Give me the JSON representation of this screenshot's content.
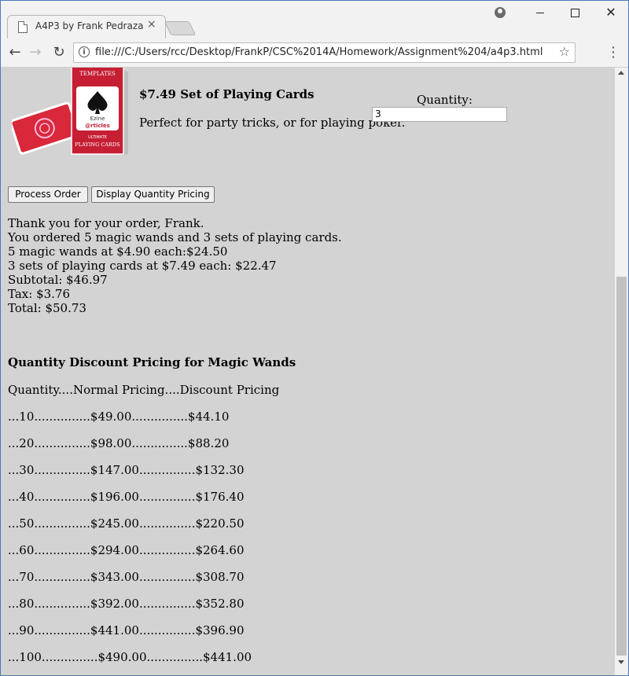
{
  "browser": {
    "tab_title": "A4P3 by Frank Pedraza",
    "tab_close": "×",
    "url": "file:///C:/Users/rcc/Desktop/FrankP/CSC%2014A/Homework/Assignment%204/a4p3.html",
    "info_glyph": "i",
    "star_glyph": "☆",
    "menu_glyph": "⋮",
    "back_glyph": "←",
    "forward_glyph": "→",
    "reload_glyph": "↻",
    "close_glyph": "✕"
  },
  "product": {
    "title": "$7.49 Set of Playing Cards",
    "description": "Perfect for party tricks, or for playing poker.",
    "quantity_label": "Quantity:",
    "quantity_value": "3",
    "image_text": {
      "brand": "TEMPLATES",
      "logo_line1": "Ezine",
      "logo_line2": "@rticles",
      "subtitle": "ULTIMATE",
      "footer": "PLAYING CARDS"
    }
  },
  "buttons": {
    "process": "Process Order",
    "pricing": "Display Quantity Pricing"
  },
  "order_summary": [
    "Thank you for your order, Frank.",
    "You ordered 5 magic wands and 3 sets of playing cards.",
    "5 magic wands at $4.90 each:$24.50",
    "3 sets of playing cards at $7.49 each: $22.47",
    "Subtotal: $46.97",
    "Tax: $3.76",
    "Total: $50.73"
  ],
  "pricing": {
    "heading": "Quantity Discount Pricing for Magic Wands",
    "header_row": "Quantity....Normal Pricing....Discount Pricing",
    "rows": [
      "...10...............$49.00...............$44.10",
      "...20...............$98.00...............$88.20",
      "...30...............$147.00...............$132.30",
      "...40...............$196.00...............$176.40",
      "...50...............$245.00...............$220.50",
      "...60...............$294.00...............$264.60",
      "...70...............$343.00...............$308.70",
      "...80...............$392.00...............$352.80",
      "...90...............$441.00...............$396.90",
      "...100...............$490.00...............$441.00"
    ]
  }
}
